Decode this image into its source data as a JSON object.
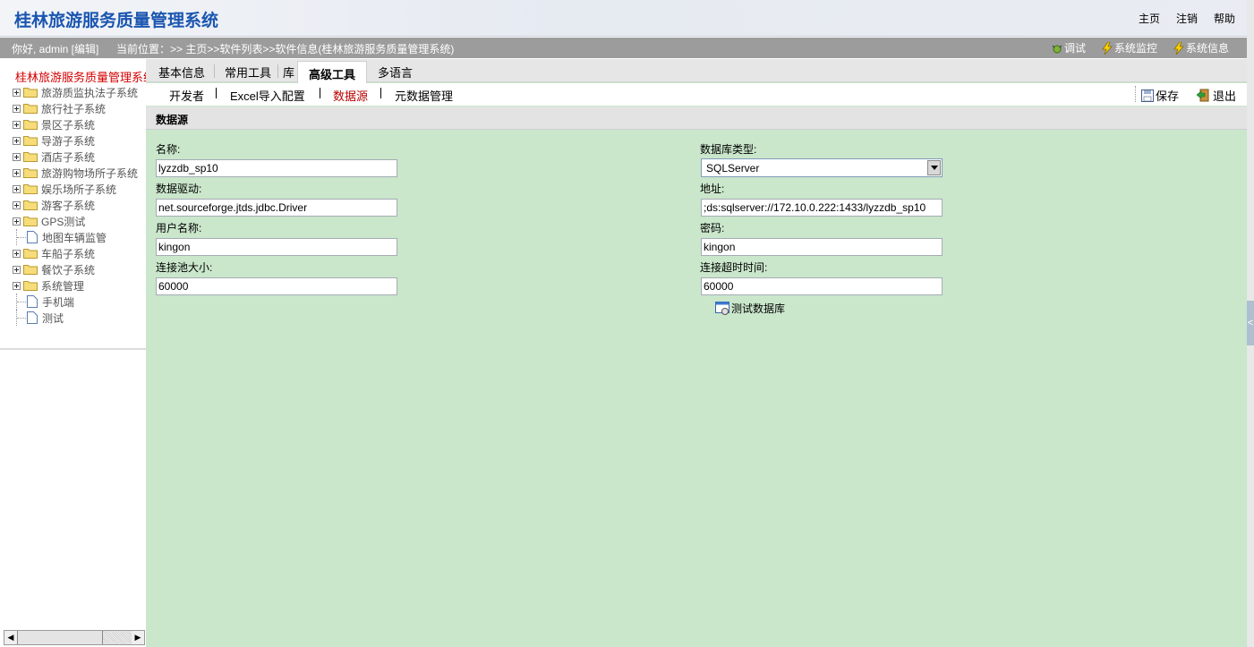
{
  "header": {
    "title": "桂林旅游服务质量管理系统",
    "links": [
      "主页",
      "注销",
      "帮助"
    ]
  },
  "infobar": {
    "greeting": "你好, admin [编辑]",
    "breadcrumb": "当前位置：>> 主页>>软件列表>>软件信息(桂林旅游服务质量管理系统)",
    "tools": [
      "调试",
      "系统监控",
      "系统信息"
    ]
  },
  "sidebar": {
    "root": "桂林旅游服务质量管理系统",
    "items": [
      {
        "label": "旅游质监执法子系统",
        "type": "folder"
      },
      {
        "label": "旅行社子系统",
        "type": "folder"
      },
      {
        "label": "景区子系统",
        "type": "folder"
      },
      {
        "label": "导游子系统",
        "type": "folder"
      },
      {
        "label": "酒店子系统",
        "type": "folder"
      },
      {
        "label": "旅游购物场所子系统",
        "type": "folder"
      },
      {
        "label": "娱乐场所子系统",
        "type": "folder"
      },
      {
        "label": "游客子系统",
        "type": "folder"
      },
      {
        "label": "GPS测试",
        "type": "folder"
      },
      {
        "label": "地图车辆监管",
        "type": "page"
      },
      {
        "label": "车船子系统",
        "type": "folder"
      },
      {
        "label": "餐饮子系统",
        "type": "folder"
      },
      {
        "label": "系统管理",
        "type": "folder"
      },
      {
        "label": "手机端",
        "type": "page"
      },
      {
        "label": "测试",
        "type": "page"
      }
    ]
  },
  "tabs": [
    "基本信息",
    "常用工具",
    "库",
    "高级工具",
    "多语言"
  ],
  "subtabs": [
    "开发者",
    "Excel导入配置",
    "数据源",
    "元数据管理"
  ],
  "actions": {
    "save": "保存",
    "exit": "退出"
  },
  "section_title": "数据源",
  "form": {
    "name_label": "名称:",
    "name_value": "lyzzdb_sp10",
    "dbtype_label": "数据库类型:",
    "dbtype_value": "SQLServer",
    "driver_label": "数据驱动:",
    "driver_value": "net.sourceforge.jtds.jdbc.Driver",
    "url_label": "地址:",
    "url_value": ";ds:sqlserver://172.10.0.222:1433/lyzzdb_sp10",
    "user_label": "用户名称:",
    "user_value": "kingon",
    "password_label": "密码:",
    "password_value": "kingon",
    "pool_label": "连接池大小:",
    "pool_value": "60000",
    "timeout_label": "连接超时时间:",
    "timeout_value": "60000",
    "test_db": "测试数据库"
  },
  "colors": {
    "title": "#1a55b0",
    "infobar": "#9c9c9c",
    "main_bg": "#cae6cb",
    "active_subtab": "#b80000",
    "root_label": "#d40000"
  }
}
